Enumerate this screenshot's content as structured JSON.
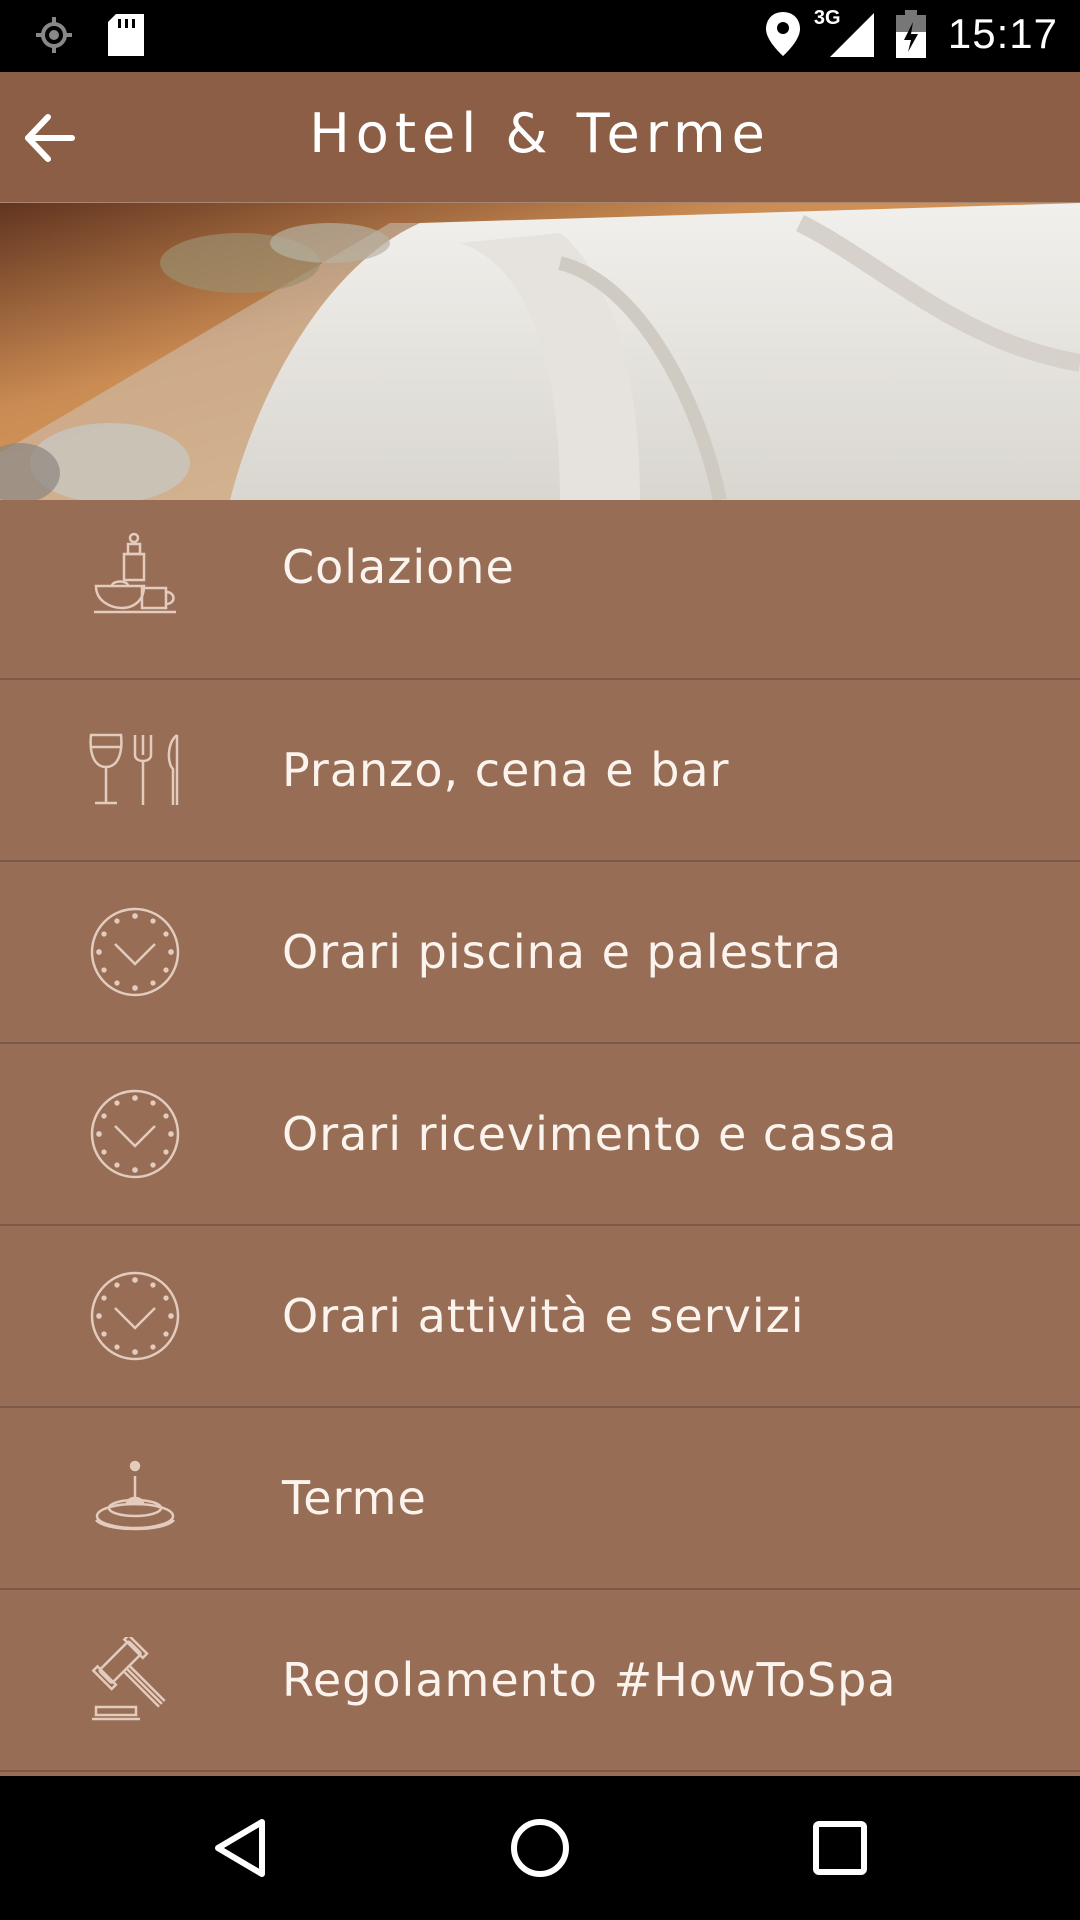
{
  "status_bar": {
    "time": "15:17",
    "network": "3G",
    "icons": [
      "gps-icon",
      "sd-card-icon",
      "location-icon",
      "signal-icon",
      "battery-icon"
    ]
  },
  "app_bar": {
    "title": "Hotel & Terme",
    "back_icon": "back-arrow-icon"
  },
  "hero": {
    "description_icon": "spa-bathrobe-image"
  },
  "menu": {
    "items": [
      {
        "label": "Colazione",
        "icon": "breakfast-icon"
      },
      {
        "label": "Pranzo, cena e bar",
        "icon": "dining-icon"
      },
      {
        "label": "Orari piscina e palestra",
        "icon": "clock-icon"
      },
      {
        "label": "Orari ricevimento e cassa",
        "icon": "clock-icon"
      },
      {
        "label": "Orari attività e servizi",
        "icon": "clock-icon"
      },
      {
        "label": "Terme",
        "icon": "water-drop-icon"
      },
      {
        "label": "Regolamento #HowToSpa",
        "icon": "gavel-icon"
      }
    ]
  },
  "nav_bar": {
    "buttons": [
      "back-triangle-icon",
      "home-circle-icon",
      "recents-square-icon"
    ]
  },
  "colors": {
    "status_bar": "#000000",
    "app_bar": "#8c5e45",
    "list_bg": "#976d55",
    "divider": "#7d5a47",
    "text": "#fbf4ee",
    "icon_stroke": "#e3cbbd"
  }
}
